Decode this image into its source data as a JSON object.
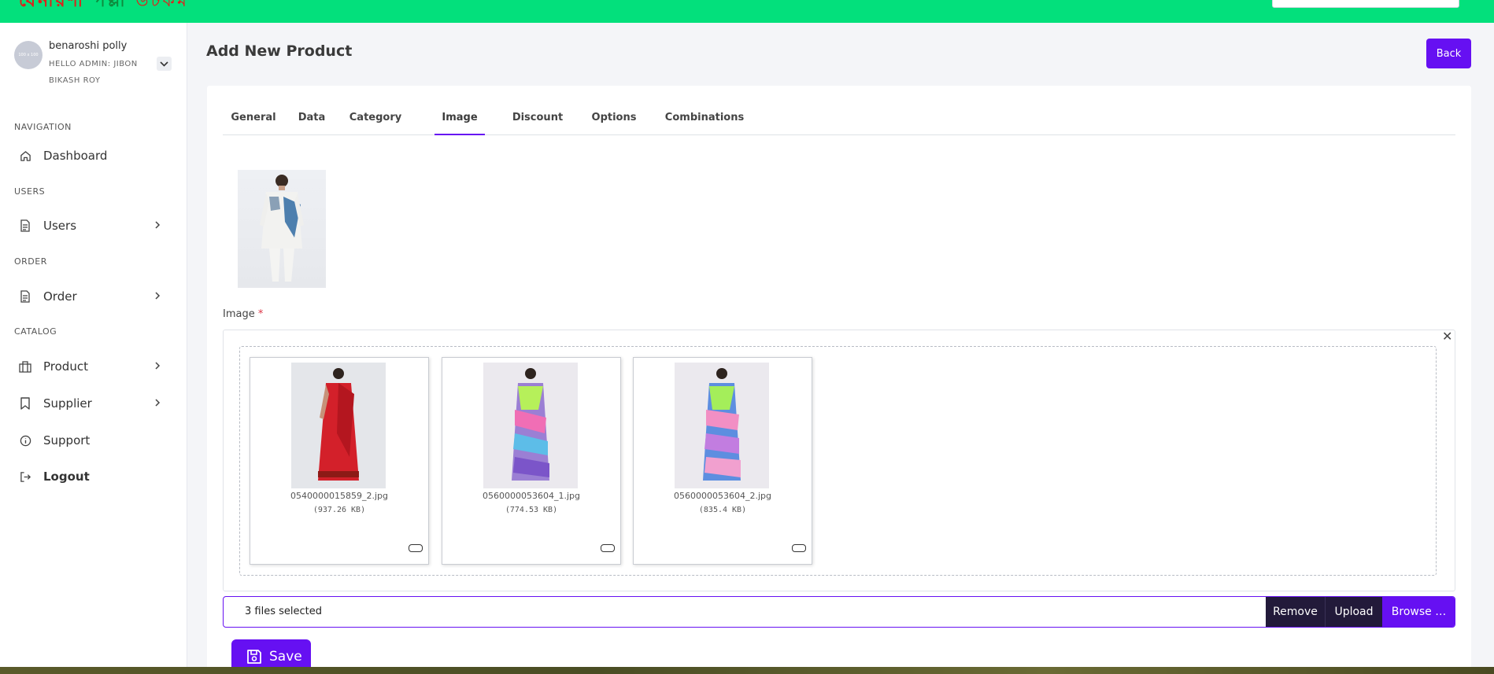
{
  "brand": {
    "part1": "বেনারশী",
    "part2": "পল্লী",
    "part3": "ডটকম"
  },
  "user": {
    "name": "benaroshi polly",
    "role": "HELLO ADMIN: JIBON BIKASH ROY",
    "avatar_text": "100 x 100"
  },
  "sidebar": {
    "sections": [
      {
        "heading": "NAVIGATION",
        "items": [
          {
            "label": "Dashboard",
            "icon": "home-icon"
          }
        ]
      },
      {
        "heading": "USERS",
        "items": [
          {
            "label": "Users",
            "icon": "file-icon"
          }
        ]
      },
      {
        "heading": "ORDER",
        "items": [
          {
            "label": "Order",
            "icon": "file-icon"
          }
        ]
      },
      {
        "heading": "CATALOG",
        "items": [
          {
            "label": "Product",
            "icon": "briefcase-icon"
          },
          {
            "label": "Supplier",
            "icon": "bookmark-icon"
          },
          {
            "label": "Support",
            "icon": "info-icon"
          },
          {
            "label": "Logout",
            "icon": "logout-icon"
          }
        ]
      }
    ]
  },
  "page": {
    "title": "Add New Product",
    "back_label": "Back"
  },
  "tabs": [
    "General",
    "Data",
    "Category",
    "Image",
    "Discount",
    "Options",
    "Combinations"
  ],
  "active_tab": "Image",
  "image_field": {
    "label": "Image",
    "required_mark": "*"
  },
  "previews": [
    {
      "name": "0540000015859_2.jpg",
      "size": "(937.26 KB)"
    },
    {
      "name": "0560000053604_1.jpg",
      "size": "(774.53 KB)"
    },
    {
      "name": "0560000053604_2.jpg",
      "size": "(835.4 KB)"
    }
  ],
  "file_input": {
    "caption": "3 files selected",
    "remove_label": "Remove",
    "upload_label": "Upload",
    "browse_label": "Browse …"
  },
  "save_label": "Save",
  "colors": {
    "accent": "#6610f2",
    "topbar": "#03e07c",
    "dark_button": "#221a3a"
  }
}
